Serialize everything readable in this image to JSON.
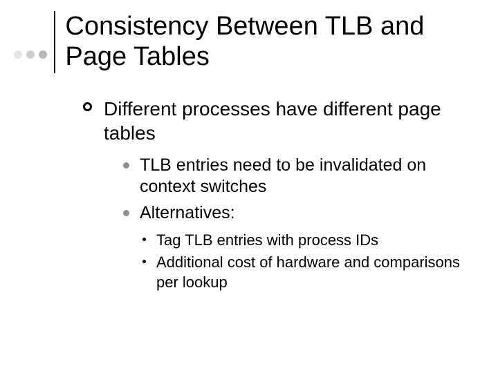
{
  "title": "Consistency Between TLB and Page Tables",
  "body": {
    "lvl1": "Different processes have different page tables",
    "lvl2": [
      "TLB entries need to be invalidated on context switches",
      "Alternatives:"
    ],
    "lvl3": [
      "Tag TLB entries with process IDs",
      "Additional cost of hardware and comparisons per lookup"
    ]
  }
}
